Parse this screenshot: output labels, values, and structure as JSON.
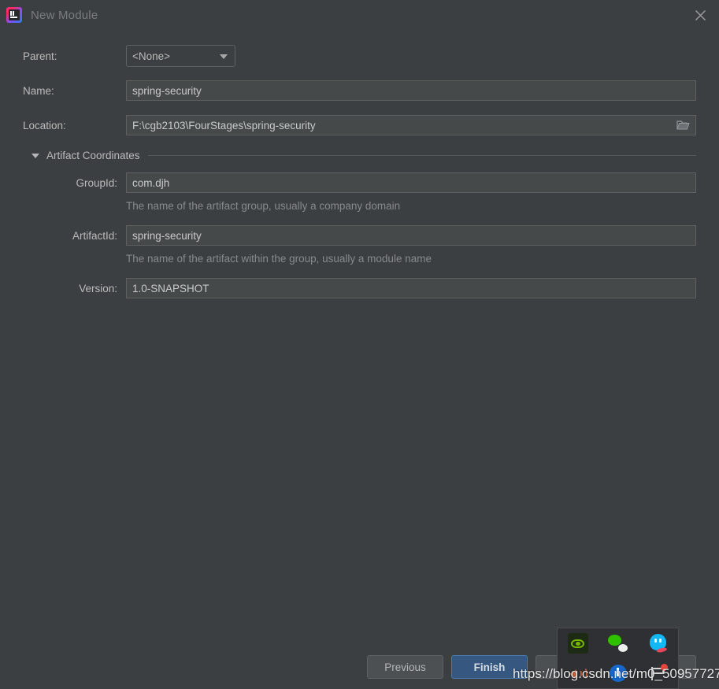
{
  "window": {
    "title": "New Module",
    "app_icon": "intellij-idea-icon",
    "close_icon": "close-icon"
  },
  "form": {
    "parent": {
      "label": "Parent:",
      "value": "<None>",
      "options": [
        "<None>"
      ],
      "arrow_icon": "chevron-down-icon"
    },
    "name": {
      "label": "Name:",
      "value": "spring-security",
      "placeholder": ""
    },
    "location": {
      "label": "Location:",
      "value": "F:\\cgb2103\\FourStages\\spring-security",
      "placeholder": "",
      "browse_icon": "folder-icon"
    }
  },
  "artifact_section": {
    "label": "Artifact Coordinates",
    "expanded": true,
    "toggle_icon": "triangle-down-icon",
    "group_id": {
      "label": "GroupId:",
      "value": "com.djh",
      "hint": "The name of the artifact group, usually a company domain"
    },
    "artifact_id": {
      "label": "ArtifactId:",
      "value": "spring-security",
      "hint": "The name of the artifact within the group, usually a module name"
    },
    "version": {
      "label": "Version:",
      "value": "1.0-SNAPSHOT",
      "hint": ""
    }
  },
  "footer": {
    "previous_label": "Previous",
    "finish_label": "Finish",
    "cancel_label": "",
    "help_label": ""
  },
  "tray_popup": {
    "icons": [
      {
        "name": "nvidia-icon"
      },
      {
        "name": "wechat-icon"
      },
      {
        "name": "qq-icon"
      },
      {
        "name": "volume-icon"
      },
      {
        "name": "blue-circle-icon"
      },
      {
        "name": "notification-flag-icon"
      }
    ]
  },
  "watermark": {
    "text": "https://blog.csdn.net/m0_50957727"
  },
  "colors": {
    "dialog_background": "#3c3f41",
    "field_background": "#45494a",
    "accent_default_button": "#365880",
    "text_primary": "#bbbbbb",
    "text_hint": "#878a8c"
  }
}
